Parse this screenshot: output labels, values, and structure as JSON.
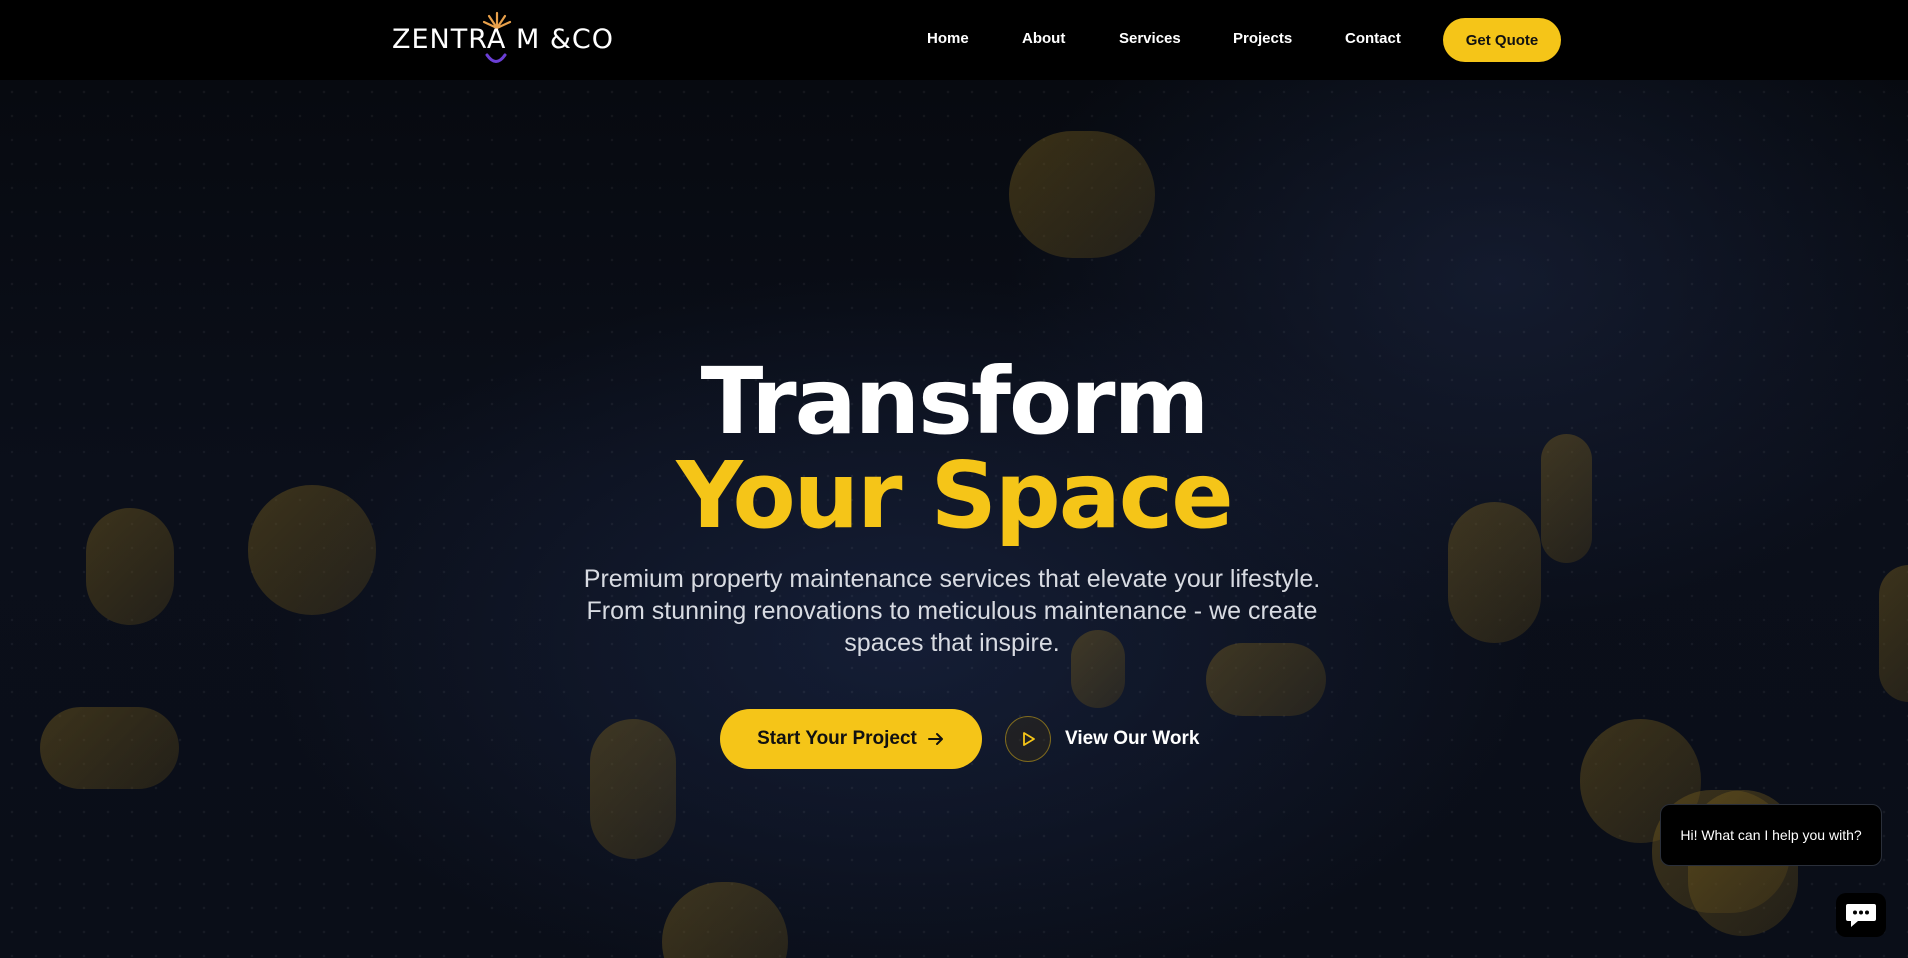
{
  "header": {
    "logo_text": "ZENTRA M &CO",
    "nav": [
      "Home",
      "About",
      "Services",
      "Projects",
      "Contact"
    ],
    "cta_label": "Get Quote"
  },
  "hero": {
    "title_line_1": "Transform",
    "title_line_2": "Your Space",
    "subtitle": "Premium property maintenance services that elevate your lifestyle. From stunning renovations to meticulous maintenance - we create spaces that inspire.",
    "primary_cta": "Start Your Project",
    "primary_cta_icon": "arrow-right-icon",
    "secondary_cta": "View Our Work",
    "secondary_cta_icon": "play-icon"
  },
  "chat": {
    "greeting": "Hi! What can I help you with?",
    "launcher_icon": "chat-icon"
  },
  "colors": {
    "accent": "#f5c518",
    "header_bg": "#000000",
    "hero_bg": "#0b0f1a",
    "text": "#ffffff"
  }
}
